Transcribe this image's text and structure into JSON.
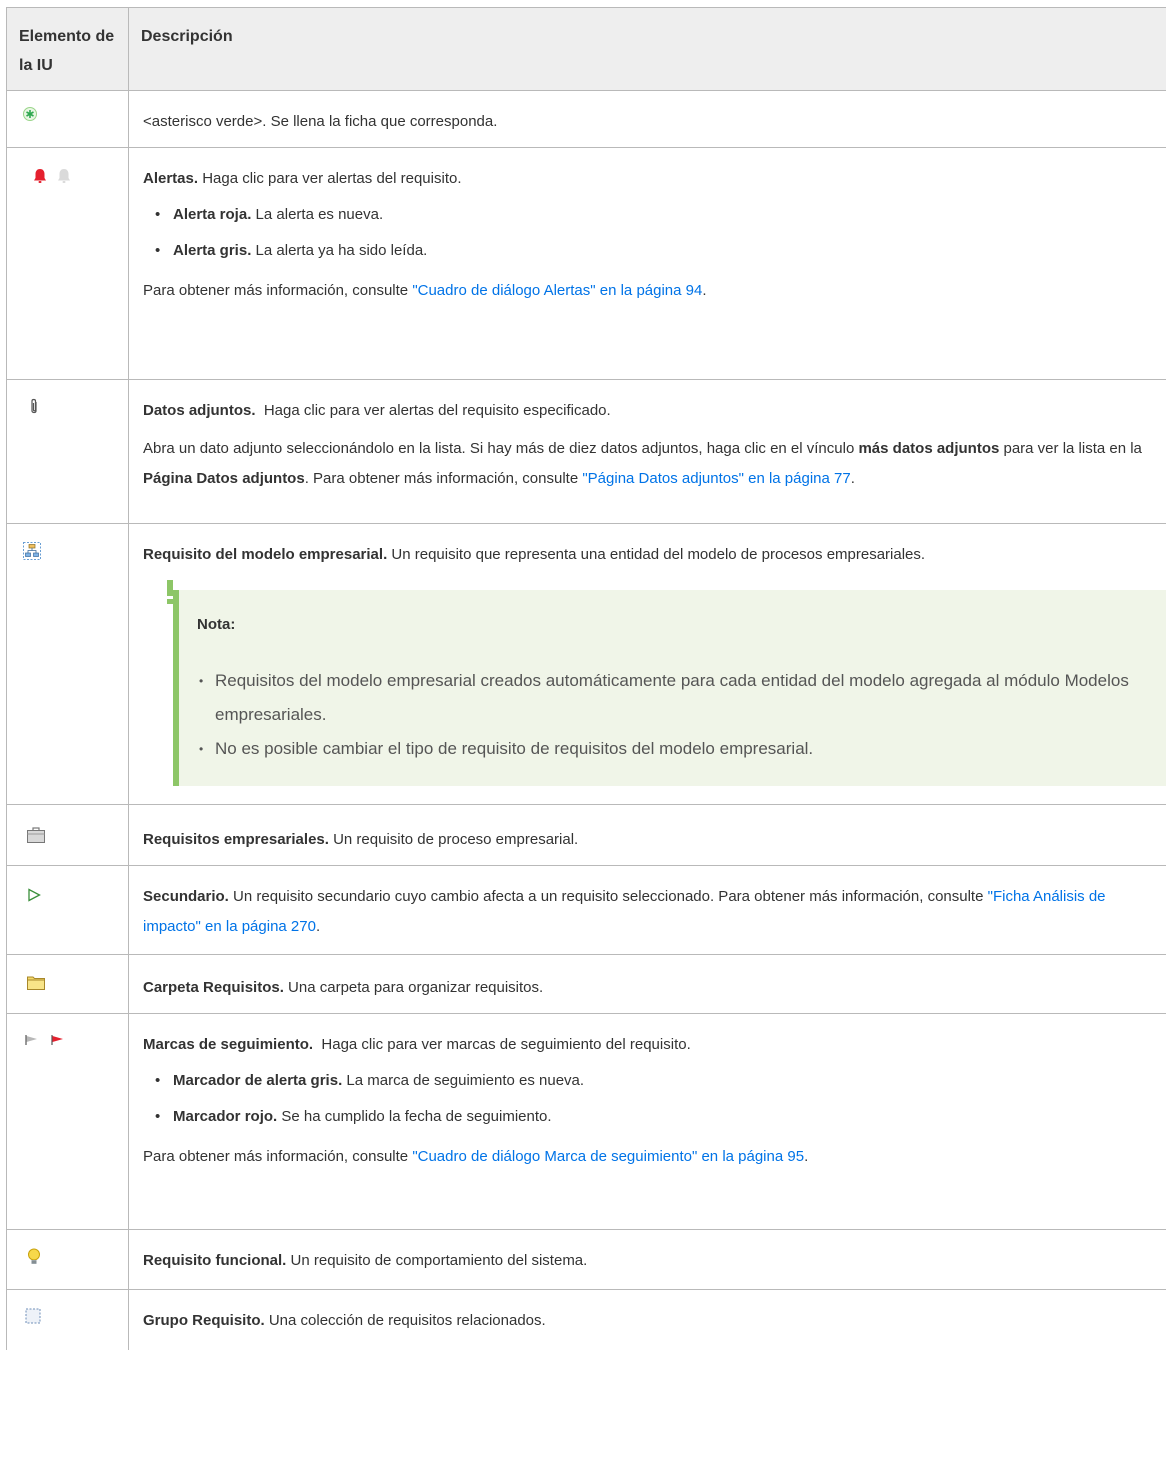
{
  "header": {
    "col1": "Elemento de la IU",
    "col2": "Descripción"
  },
  "rows": {
    "asterisk": {
      "icon": "green-asterisk-icon",
      "text": "<asterisco verde>. Se llena la ficha que corresponda."
    },
    "alerts": {
      "icons": [
        "red-bell-icon",
        "gray-bell-icon"
      ],
      "title": "Alertas.",
      "text": " Haga clic para ver alertas del requisito.",
      "bullets": [
        {
          "bold": "Alerta roja.",
          "text": " La alerta es nueva."
        },
        {
          "bold": "Alerta gris.",
          "text": " La alerta ya ha sido leída."
        }
      ],
      "more_prefix": "Para obtener más información, consulte ",
      "more_link": "\"Cuadro de diálogo Alertas\" en la página 94",
      "more_suffix": "."
    },
    "attachments": {
      "icon": "paperclip-icon",
      "title": "Datos adjuntos.",
      "text": "  Haga clic para ver alertas del requisito especificado.",
      "p2_a": "Abra un dato adjunto seleccionándolo en la lista. Si hay más de diez datos adjuntos, haga clic en el vínculo ",
      "p2_b1": "más datos adjuntos",
      "p2_c": " para ver la lista en la ",
      "p2_b2": "Página Datos adjuntos",
      "p2_d": ". Para obtener más información, consulte ",
      "p2_link": "\"Página Datos adjuntos\" en la página 77",
      "p2_e": "."
    },
    "business_model": {
      "icon": "business-model-icon",
      "title": "Requisito del modelo empresarial.",
      "text": " Un requisito que representa una entidad del modelo de procesos empresariales.",
      "note_title": "Nota:",
      "note_items": [
        "Requisitos del modelo empresarial creados automáticamente para cada entidad del modelo agregada al módulo Modelos empresariales.",
        "No es posible cambiar el tipo de requisito de requisitos del modelo empresarial."
      ]
    },
    "business": {
      "icon": "briefcase-icon",
      "title": "Requisitos empresariales.",
      "text": " Un requisito de proceso empresarial."
    },
    "child": {
      "icon": "play-outline-icon",
      "title": "Secundario.",
      "text": " Un requisito secundario cuyo cambio afecta a un requisito seleccionado. Para obtener más información, consulte ",
      "link": "\"Ficha Análisis de impacto\" en la página 270",
      "suffix": "."
    },
    "folder": {
      "icon": "folder-icon",
      "title": "Carpeta Requisitos.",
      "text": " Una carpeta para organizar requisitos."
    },
    "flags": {
      "icons": [
        "gray-flag-icon",
        "red-flag-icon"
      ],
      "title": "Marcas de seguimiento.",
      "text": "  Haga clic para ver marcas de seguimiento del requisito.",
      "bullets": [
        {
          "bold": "Marcador de alerta gris.",
          "text": " La marca de seguimiento es nueva."
        },
        {
          "bold": "Marcador rojo.",
          "text": " Se ha cumplido la fecha de seguimiento."
        }
      ],
      "more_prefix": "Para obtener más información, consulte ",
      "more_link": "\"Cuadro de diálogo Marca de seguimiento\" en la página 95",
      "more_suffix": "."
    },
    "functional": {
      "icon": "lightbulb-icon",
      "title": "Requisito funcional.",
      "text": " Un requisito de comportamiento del sistema."
    },
    "group": {
      "icon": "dashed-group-icon",
      "title": "Grupo Requisito.",
      "text": " Una colección de requisitos relacionados."
    }
  },
  "colors": {
    "link": "#0073e7",
    "note_bar": "#8dc667",
    "note_bg": "#f0f5e8",
    "header_bg": "#eeeeee"
  }
}
